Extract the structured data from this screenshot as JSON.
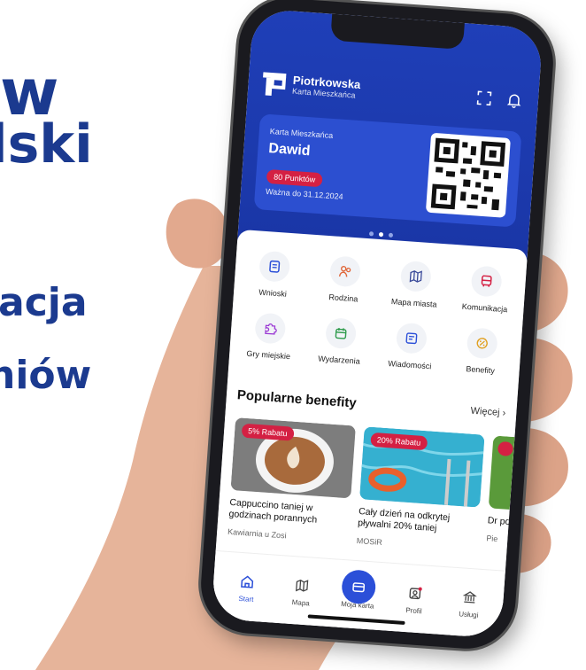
{
  "background_text": [
    "w",
    "lski",
    "acja",
    "niów"
  ],
  "app": {
    "brand_name": "Piotrkowska",
    "brand_sub": "Karta Mieszkańca"
  },
  "card": {
    "label": "Karta Mieszkańca",
    "name": "Dawid",
    "points": "80 Punktów",
    "valid": "Ważna do 31.12.2024"
  },
  "services": [
    {
      "label": "Wnioski",
      "icon": "document-icon"
    },
    {
      "label": "Rodzina",
      "icon": "family-icon"
    },
    {
      "label": "Mapa miasta",
      "icon": "map-icon"
    },
    {
      "label": "Komunikacja",
      "icon": "bus-icon"
    },
    {
      "label": "Gry miejskie",
      "icon": "puzzle-icon"
    },
    {
      "label": "Wydarzenia",
      "icon": "calendar-icon"
    },
    {
      "label": "Wiadomości",
      "icon": "message-icon"
    },
    {
      "label": "Benefity",
      "icon": "discount-icon"
    }
  ],
  "benefits_section": {
    "title": "Popularne benefity",
    "more": "Więcej"
  },
  "benefits": [
    {
      "badge": "5% Rabatu",
      "title": "Cappuccino taniej w godzinach porannych",
      "subtitle": "Kawiarnia u Zosi"
    },
    {
      "badge": "20% Rabatu",
      "title": "Cały dzień na odkrytej pływalni 20% taniej",
      "subtitle": "MOSiR"
    },
    {
      "badge": "",
      "title": "Dr po",
      "subtitle": "Pie"
    }
  ],
  "tabs": [
    {
      "label": "Start",
      "icon": "home-icon"
    },
    {
      "label": "Mapa",
      "icon": "map-icon"
    },
    {
      "label": "Moja karta",
      "icon": "card-icon"
    },
    {
      "label": "Profil",
      "icon": "profile-icon"
    },
    {
      "label": "Usługi",
      "icon": "bank-icon"
    }
  ],
  "colors": {
    "primary": "#1f3fb8",
    "accent": "#2b4fd8",
    "badge": "#d42043",
    "background_text": "#1b3a8f"
  }
}
